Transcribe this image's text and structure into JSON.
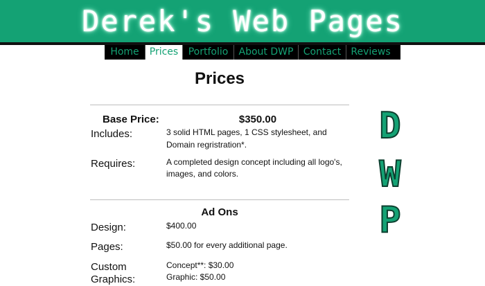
{
  "header": {
    "title": "Derek's Web Pages"
  },
  "nav": {
    "items": [
      {
        "label": "Home"
      },
      {
        "label": "Prices",
        "active": true
      },
      {
        "label": "Portfolio"
      },
      {
        "label": "About DWP"
      },
      {
        "label": "Contact"
      },
      {
        "label": "Reviews"
      }
    ]
  },
  "main": {
    "title": "Prices",
    "base": {
      "label": "Base Price:",
      "price": "$350.00",
      "includes_label": "Includes:",
      "includes_line1": "3 solid HTML pages, 1 CSS stylesheet, and",
      "includes_line2": "Domain regristration*.",
      "requires_label": "Requires:",
      "requires_line1": "A completed design concept including all logo's,",
      "requires_line2": "images, and colors."
    },
    "addons": {
      "heading": "Ad Ons",
      "design_label": "Design:",
      "design_value": "$400.00",
      "pages_label": "Pages:",
      "pages_value": "$50.00 for every additional page.",
      "custom_label_line1": "Custom",
      "custom_label_line2": "Graphics:",
      "custom_value_line1": "Concept**: $30.00",
      "custom_value_line2": "Graphic: $50.00"
    }
  },
  "side_logo": {
    "letters": [
      "D",
      "W",
      "P"
    ]
  },
  "colors": {
    "brand_green": "#14a274",
    "nav_background": "#000000"
  }
}
